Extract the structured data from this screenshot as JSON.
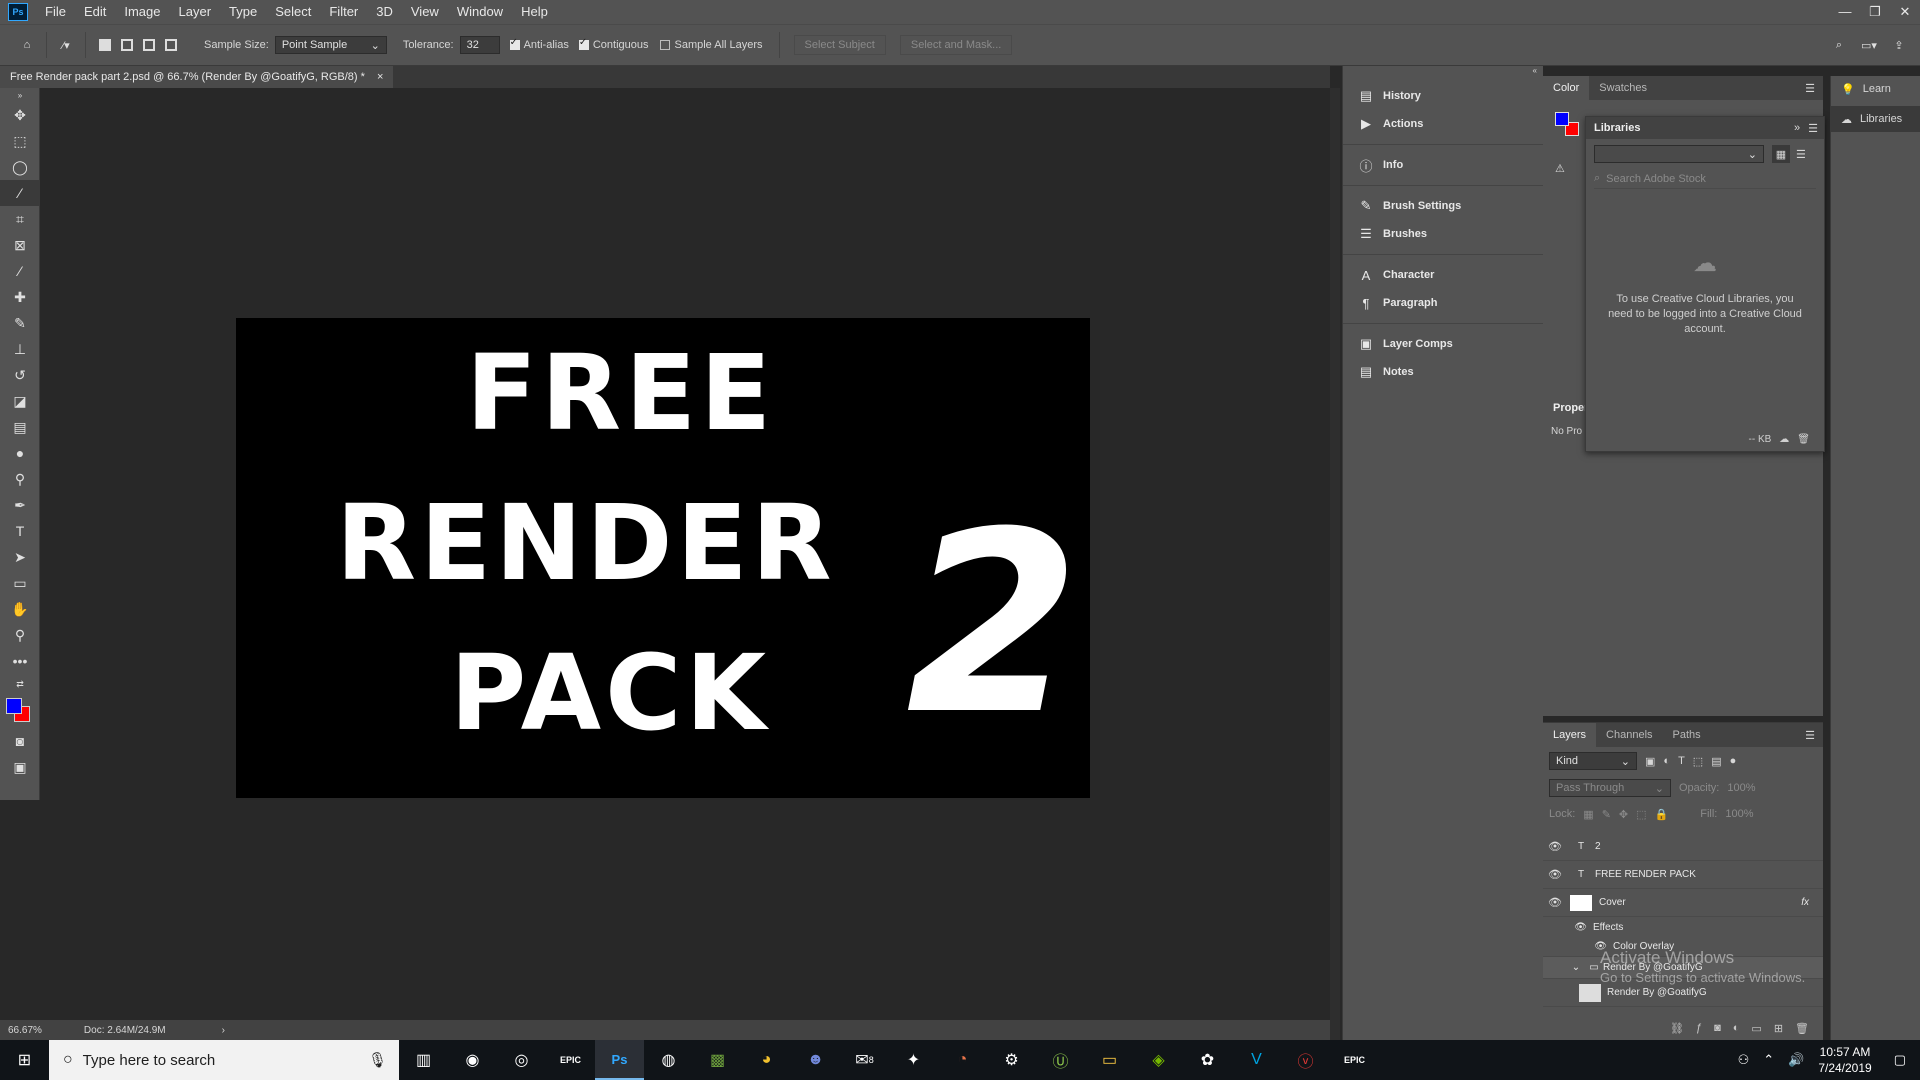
{
  "app": {
    "menus": [
      "File",
      "Edit",
      "Image",
      "Layer",
      "Type",
      "Select",
      "Filter",
      "3D",
      "View",
      "Window",
      "Help"
    ]
  },
  "options": {
    "sample_size_label": "Sample Size:",
    "sample_size_value": "Point Sample",
    "tolerance_label": "Tolerance:",
    "tolerance_value": "32",
    "anti_alias": "Anti-alias",
    "contiguous": "Contiguous",
    "sample_all_layers": "Sample All Layers",
    "select_subject": "Select Subject",
    "select_and_mask": "Select and Mask..."
  },
  "document": {
    "tab_title": "Free Render pack part 2.psd @ 66.7% (Render By @GoatifyG, RGB/8) *",
    "art_line1": "FREE",
    "art_line2": "RENDER",
    "art_line3": "PACK",
    "art_number": "2"
  },
  "status": {
    "zoom": "66.67%",
    "doc": "Doc: 2.64M/24.9M"
  },
  "panels_collapsed": [
    {
      "label": "History",
      "icon": "history-icon"
    },
    {
      "label": "Actions",
      "icon": "actions-icon"
    },
    {
      "label": "Info",
      "icon": "info-icon"
    },
    {
      "label": "Brush Settings",
      "icon": "brush-settings-icon"
    },
    {
      "label": "Brushes",
      "icon": "brushes-icon"
    },
    {
      "label": "Character",
      "icon": "character-icon"
    },
    {
      "label": "Paragraph",
      "icon": "paragraph-icon"
    },
    {
      "label": "Layer Comps",
      "icon": "layer-comps-icon"
    },
    {
      "label": "Notes",
      "icon": "notes-icon"
    }
  ],
  "color_panel": {
    "tab_color": "Color",
    "tab_swatches": "Swatches",
    "fg_color": "#0000ff",
    "bg_color": "#ff0000"
  },
  "libraries": {
    "title": "Libraries",
    "search_placeholder": "Search Adobe Stock",
    "message": "To use Creative Cloud Libraries, you need to be logged into a Creative Cloud account.",
    "size": "-- KB"
  },
  "properties": {
    "tab": "Proper",
    "content": "No Pro"
  },
  "right_strip": {
    "learn": "Learn",
    "libraries": "Libraries"
  },
  "layers_panel": {
    "tabs": [
      "Layers",
      "Channels",
      "Paths"
    ],
    "kind": "Kind",
    "blend_mode": "Pass Through",
    "opacity_label": "Opacity:",
    "opacity_value": "100%",
    "lock_label": "Lock:",
    "fill_label": "Fill:",
    "fill_value": "100%",
    "layers": [
      {
        "name": "2",
        "type": "text"
      },
      {
        "name": "FREE RENDER  PACK",
        "type": "text"
      },
      {
        "name": "Cover",
        "type": "shape",
        "fx": "fx"
      },
      {
        "name": "Effects",
        "type": "effects"
      },
      {
        "name": "Color Overlay",
        "type": "effect"
      },
      {
        "name": "Render By @GoatifyG",
        "type": "group"
      },
      {
        "name": "Render By @GoatifyG",
        "type": "image"
      }
    ]
  },
  "watermark": {
    "line1": "Activate Windows",
    "line2": "Go to Settings to activate Windows."
  },
  "taskbar": {
    "search_placeholder": "Type here to search",
    "time": "10:57 AM",
    "date": "7/24/2019",
    "epic1": "EPIC",
    "epic2": "EPIC",
    "ps": "Ps",
    "mail_badge": "8"
  }
}
